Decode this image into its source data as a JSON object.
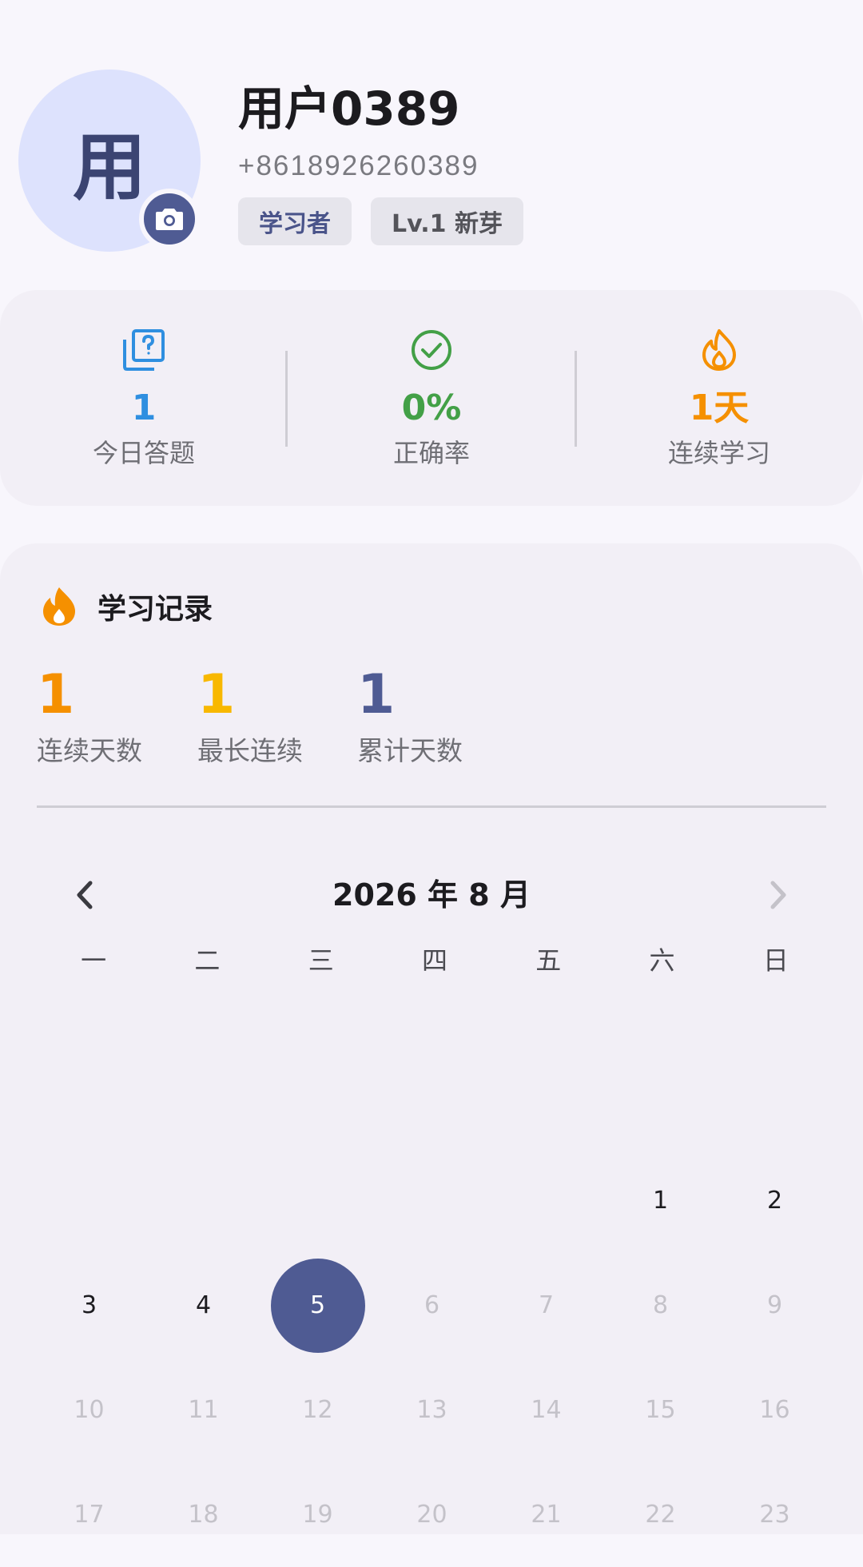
{
  "profile": {
    "avatar_char": "用",
    "name": "用户0389",
    "phone": "+8618926260389",
    "badges": [
      "学习者",
      "Lv.1 新芽"
    ],
    "camera_icon": "camera-icon"
  },
  "stats": [
    {
      "icon": "question-book-icon",
      "value": "1",
      "label": "今日答题",
      "color": "#2f8fe0"
    },
    {
      "icon": "check-circle-icon",
      "value": "0%",
      "label": "正确率",
      "color": "#43a047"
    },
    {
      "icon": "flame-icon",
      "value": "1天",
      "label": "连续学习",
      "color": "#f59000"
    }
  ],
  "record": {
    "title": "学习记录",
    "icon": "flame-icon",
    "streaks": [
      {
        "value": "1",
        "label": "连续天数",
        "color": "#f59000"
      },
      {
        "value": "1",
        "label": "最长连续",
        "color": "#f8b800"
      },
      {
        "value": "1",
        "label": "累计天数",
        "color": "#4f5b93"
      }
    ]
  },
  "calendar": {
    "title": "2026 年 8 月",
    "prev_icon": "chevron-left-icon",
    "next_icon": "chevron-right-icon",
    "weekdays": [
      "一",
      "二",
      "三",
      "四",
      "五",
      "六",
      "日"
    ],
    "leading_blanks": 5,
    "today": 5,
    "visible_days": [
      1,
      2,
      3,
      4,
      5,
      6,
      7,
      8,
      9,
      10,
      11,
      12,
      13,
      14,
      15,
      16,
      17,
      18,
      19,
      20,
      21,
      22,
      23
    ],
    "accent_color": "#4f5b93"
  }
}
